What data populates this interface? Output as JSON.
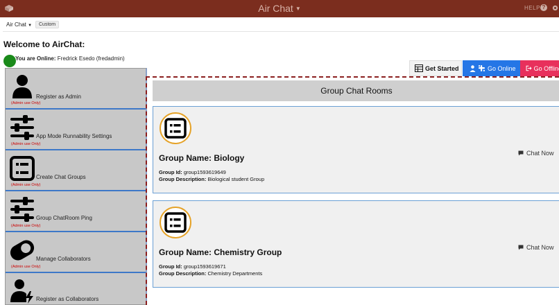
{
  "app": {
    "title": "Air Chat",
    "help_label": "HELP"
  },
  "tabs": {
    "app_menu": "Air Chat",
    "custom_label": "Custom"
  },
  "welcome": {
    "heading": "Welcome to AirChat:",
    "online_prefix": "You are Online:",
    "user": "Fredrick Esedo (fredadmin)"
  },
  "actions": {
    "get_started": "Get Started",
    "go_online": "Go Online",
    "go_offline": "Go Offline"
  },
  "sidebar": {
    "items": [
      {
        "label": "Register as Admin",
        "note": "(Admin use Only)",
        "icon": "user-icon"
      },
      {
        "label": "App Mode Runnability Settings",
        "note": "(Admin use Only)",
        "icon": "sliders-icon"
      },
      {
        "label": "Create Chat Groups",
        "note": "(Admin use Only)",
        "icon": "list-icon"
      },
      {
        "label": "Group ChatRoom Ping",
        "note": "(Admin use Only)",
        "icon": "sliders-icon"
      },
      {
        "label": "Manage Collaborators",
        "note": "(Admin use Only)",
        "icon": "toggle-icon"
      },
      {
        "label": "Register as Collaborators",
        "note": "",
        "icon": "user-bolt-icon"
      }
    ]
  },
  "main": {
    "header": "Group Chat Rooms",
    "groups": [
      {
        "name": "Group Name: Biology",
        "id_label": "Group Id:",
        "id_value": "group1593619649",
        "desc_label": "Group Description:",
        "desc_value": "Biological student Group",
        "chat_label": "Chat Now"
      },
      {
        "name": "Group Name: Chemistry Group",
        "id_label": "Group Id:",
        "id_value": "group1593619671",
        "desc_label": "Group Description:",
        "desc_value": "Chemistry Departments",
        "chat_label": "Chat Now"
      }
    ]
  },
  "colors": {
    "topbar": "#7b2d1e",
    "online_dot": "#1a8a1a",
    "go_online": "#2576e6",
    "go_offline": "#e8305c",
    "admin_note": "#cc0000",
    "group_icon_ring": "#e5a227"
  }
}
